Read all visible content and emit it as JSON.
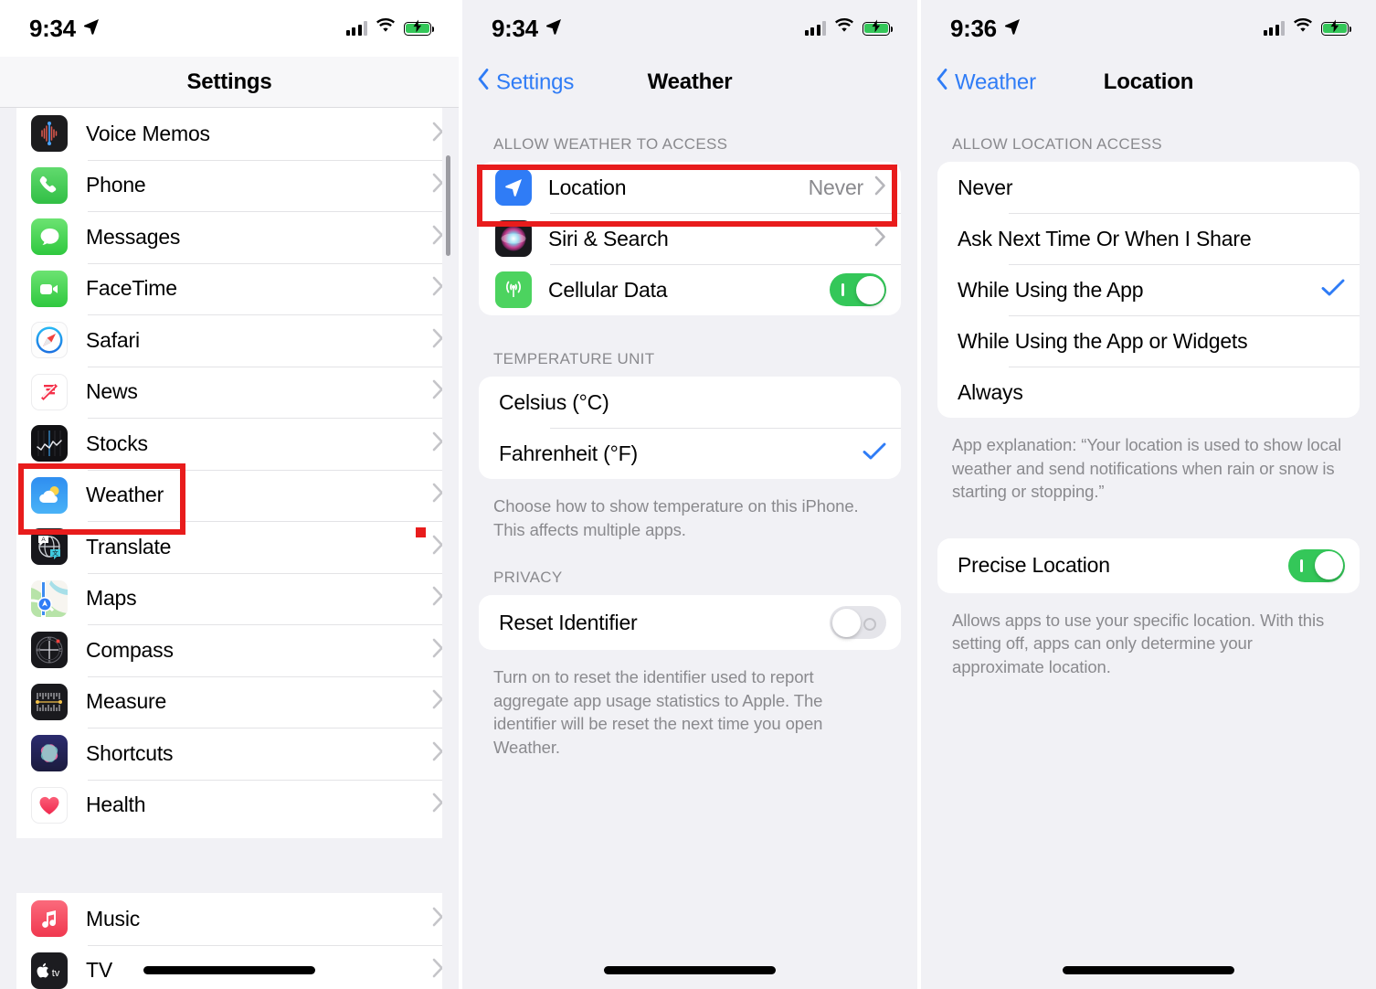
{
  "statusbar": {
    "time_panel1": "9:34",
    "time_panel2": "9:34",
    "time_panel3": "9:36",
    "location_arrow_icon": "location-arrow-icon",
    "cellular_icon": "cellular-signal-icon",
    "wifi_icon": "wifi-icon",
    "battery_icon": "battery-charging-icon"
  },
  "panel1": {
    "nav": {
      "title": "Settings"
    },
    "group1": [
      {
        "label": "Voice Memos",
        "icon": "voice-memos-icon"
      },
      {
        "label": "Phone",
        "icon": "phone-icon"
      },
      {
        "label": "Messages",
        "icon": "messages-icon"
      },
      {
        "label": "FaceTime",
        "icon": "facetime-icon"
      },
      {
        "label": "Safari",
        "icon": "safari-icon"
      },
      {
        "label": "News",
        "icon": "news-icon"
      },
      {
        "label": "Stocks",
        "icon": "stocks-icon"
      },
      {
        "label": "Weather",
        "icon": "weather-icon"
      },
      {
        "label": "Translate",
        "icon": "translate-icon"
      },
      {
        "label": "Maps",
        "icon": "maps-icon"
      },
      {
        "label": "Compass",
        "icon": "compass-icon"
      },
      {
        "label": "Measure",
        "icon": "measure-icon"
      },
      {
        "label": "Shortcuts",
        "icon": "shortcuts-icon"
      },
      {
        "label": "Health",
        "icon": "health-icon"
      }
    ],
    "group2": [
      {
        "label": "Music",
        "icon": "music-icon"
      },
      {
        "label": "TV",
        "icon": "tv-icon"
      }
    ],
    "highlight": "Weather"
  },
  "panel2": {
    "nav": {
      "back": "Settings",
      "title": "Weather"
    },
    "section_access": {
      "header": "ALLOW WEATHER TO ACCESS",
      "rows": [
        {
          "label": "Location",
          "value": "Never",
          "icon": "location-arrow-icon",
          "accessory": "chevron"
        },
        {
          "label": "Siri & Search",
          "value": "",
          "icon": "siri-icon",
          "accessory": "chevron"
        },
        {
          "label": "Cellular Data",
          "value": "",
          "icon": "cellular-data-icon",
          "accessory": "toggle-on"
        }
      ]
    },
    "section_temp": {
      "header": "TEMPERATURE UNIT",
      "rows": [
        {
          "label": "Celsius (°C)",
          "selected": false
        },
        {
          "label": "Fahrenheit (°F)",
          "selected": true
        }
      ],
      "footer": "Choose how to show temperature on this iPhone. This affects multiple apps."
    },
    "section_privacy": {
      "header": "PRIVACY",
      "rows": [
        {
          "label": "Reset Identifier",
          "accessory": "toggle-off"
        }
      ],
      "footer": "Turn on to reset the identifier used to report aggregate app usage statistics to Apple. The identifier will be reset the next time you open Weather."
    },
    "highlight": "Location"
  },
  "panel3": {
    "nav": {
      "back": "Weather",
      "title": "Location"
    },
    "section_access": {
      "header": "ALLOW LOCATION ACCESS",
      "rows": [
        {
          "label": "Never",
          "selected": false
        },
        {
          "label": "Ask Next Time Or When I Share",
          "selected": false
        },
        {
          "label": "While Using the App",
          "selected": true
        },
        {
          "label": "While Using the App or Widgets",
          "selected": false
        },
        {
          "label": "Always",
          "selected": false
        }
      ],
      "footer": "App explanation: “Your location is used to show local weather and send notifications when rain or snow is starting or stopping.”"
    },
    "section_precise": {
      "rows": [
        {
          "label": "Precise Location",
          "accessory": "toggle-on"
        }
      ],
      "footer": "Allows apps to use your specific location. With this setting off, apps can only determine your approximate location."
    }
  },
  "colors": {
    "accent_blue": "#2f7cf6",
    "highlight_red": "#e81c1c",
    "toggle_green": "#34c759",
    "secondary_text": "#8a8a8e",
    "background": "#f1f1f5"
  }
}
